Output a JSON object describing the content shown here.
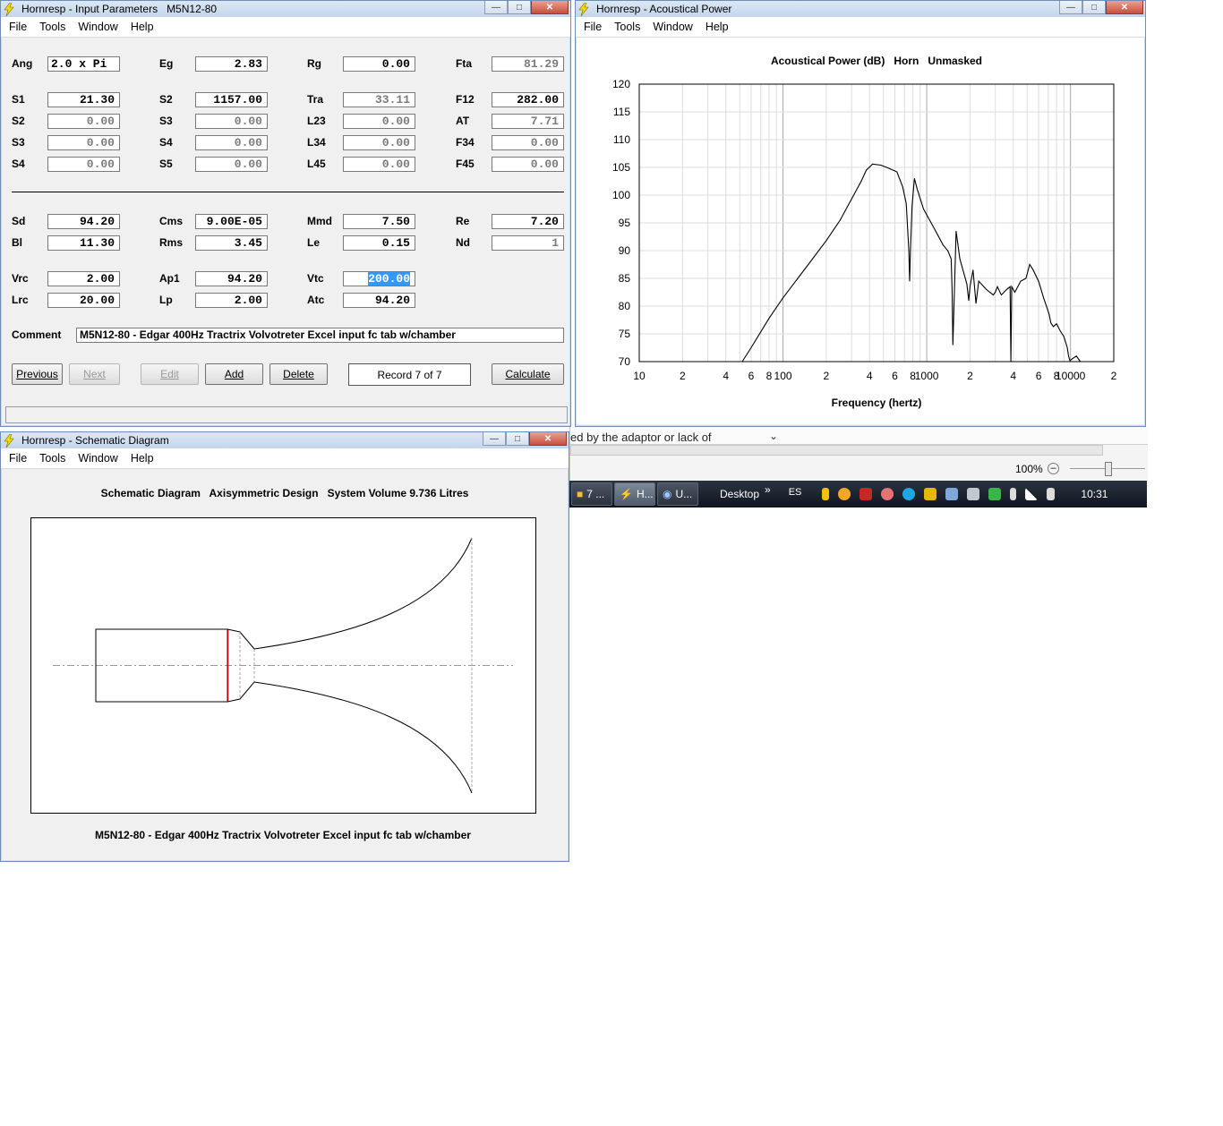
{
  "input_window": {
    "title": "Hornresp - Input Parameters   M5N12-80",
    "menu": [
      "File",
      "Tools",
      "Window",
      "Help"
    ],
    "params": [
      {
        "label": "Ang",
        "value": "2.0 x Pi",
        "grey": false
      },
      {
        "label": "Eg",
        "value": "2.83",
        "grey": false
      },
      {
        "label": "Rg",
        "value": "0.00",
        "grey": false
      },
      {
        "label": "Fta",
        "value": "81.29",
        "grey": true
      },
      {
        "label": "S1",
        "value": "21.30",
        "grey": false
      },
      {
        "label": "S2",
        "value": "1157.00",
        "grey": false
      },
      {
        "label": "Tra",
        "value": "33.11",
        "grey": true
      },
      {
        "label": "F12",
        "value": "282.00",
        "grey": false
      },
      {
        "label": "S2",
        "value": "0.00",
        "grey": true
      },
      {
        "label": "S3",
        "value": "0.00",
        "grey": true
      },
      {
        "label": "L23",
        "value": "0.00",
        "grey": true
      },
      {
        "label": "AT",
        "value": "7.71",
        "grey": true
      },
      {
        "label": "S3",
        "value": "0.00",
        "grey": true
      },
      {
        "label": "S4",
        "value": "0.00",
        "grey": true
      },
      {
        "label": "L34",
        "value": "0.00",
        "grey": true
      },
      {
        "label": "F34",
        "value": "0.00",
        "grey": true
      },
      {
        "label": "S4",
        "value": "0.00",
        "grey": true
      },
      {
        "label": "S5",
        "value": "0.00",
        "grey": true
      },
      {
        "label": "L45",
        "value": "0.00",
        "grey": true
      },
      {
        "label": "F45",
        "value": "0.00",
        "grey": true
      },
      {
        "label": "Sd",
        "value": "94.20",
        "grey": false
      },
      {
        "label": "Cms",
        "value": "9.00E-05",
        "grey": false
      },
      {
        "label": "Mmd",
        "value": "7.50",
        "grey": false
      },
      {
        "label": "Re",
        "value": "7.20",
        "grey": false
      },
      {
        "label": "Bl",
        "value": "11.30",
        "grey": false
      },
      {
        "label": "Rms",
        "value": "3.45",
        "grey": false
      },
      {
        "label": "Le",
        "value": "0.15",
        "grey": false
      },
      {
        "label": "Nd",
        "value": "1",
        "grey": true
      },
      {
        "label": "Vrc",
        "value": "2.00",
        "grey": false
      },
      {
        "label": "Ap1",
        "value": "94.20",
        "grey": false
      },
      {
        "label": "Vtc",
        "value": "200.00",
        "grey": false,
        "selected": true
      },
      {
        "label": "Lrc",
        "value": "20.00",
        "grey": false
      },
      {
        "label": "Lp",
        "value": "2.00",
        "grey": false
      },
      {
        "label": "Atc",
        "value": "94.20",
        "grey": false
      }
    ],
    "comment_label": "Comment",
    "comment_value": "M5N12-80 - Edgar 400Hz Tractrix Volvotreter Excel input fc tab w/chamber",
    "buttons": {
      "previous": "Previous",
      "next": "Next",
      "edit": "Edit",
      "add": "Add",
      "delete": "Delete",
      "record": "Record 7 of 7",
      "calculate": "Calculate"
    }
  },
  "power_window": {
    "title": "Hornresp - Acoustical Power",
    "menu": [
      "File",
      "Tools",
      "Window",
      "Help"
    ],
    "chart_title": "Acoustical Power (dB)   Horn   Unmasked",
    "xlabel": "Frequency (hertz)",
    "x_tick_labels": [
      "10",
      "2",
      "4",
      "6",
      "8",
      "100",
      "2",
      "4",
      "6",
      "8",
      "1000",
      "2",
      "4",
      "6",
      "8",
      "10000",
      "2"
    ],
    "y_tick_labels": [
      "120",
      "115",
      "110",
      "105",
      "100",
      "95",
      "90",
      "85",
      "80",
      "75",
      "70"
    ]
  },
  "chart_data": {
    "type": "line",
    "title": "Acoustical Power (dB)   Horn   Unmasked",
    "xlabel": "Frequency (hertz)",
    "ylabel": "",
    "x_scale": "log",
    "xlim": [
      10,
      20000
    ],
    "ylim": [
      70,
      120
    ],
    "grid": true,
    "series": [
      {
        "x": [
          52,
          60,
          80,
          100,
          150,
          200,
          250,
          300,
          350,
          380,
          420,
          480,
          550,
          620,
          680,
          720,
          750,
          760,
          770,
          790,
          820,
          860,
          950,
          1100,
          1300,
          1400,
          1480,
          1500,
          1520,
          1550,
          1600,
          1700,
          1900,
          1960,
          2000,
          2100,
          2200,
          2300,
          2600,
          2900,
          3000,
          3100,
          3300,
          3600,
          3800,
          3850,
          3900,
          4100,
          4500,
          4900,
          5200,
          5500,
          6000,
          6500,
          6900,
          7100,
          7300,
          7600,
          8000,
          8500,
          9000,
          9300,
          9500,
          9700,
          9900,
          10400,
          11000,
          11700
        ],
        "y": [
          70,
          72.5,
          77.8,
          81.5,
          87.5,
          91.8,
          95.5,
          99.3,
          102.5,
          104.5,
          105.6,
          105.4,
          104.8,
          104.2,
          101.5,
          98.5,
          90,
          84.5,
          90,
          98,
          103,
          101,
          97.5,
          94.5,
          91,
          90,
          88.5,
          83,
          73,
          81,
          93.5,
          88.5,
          84,
          81,
          83.5,
          86.5,
          80.5,
          84.5,
          83,
          82,
          82.5,
          83.5,
          82,
          83,
          83.5,
          70,
          83.5,
          82.5,
          84.5,
          85,
          87.5,
          86.5,
          84.5,
          81.5,
          79.5,
          78.5,
          77,
          76.3,
          76.8,
          75.5,
          74.5,
          73.3,
          72.5,
          71,
          70.2,
          70.6,
          71,
          70
        ]
      }
    ]
  },
  "schematic_window": {
    "title": "Hornresp - Schematic Diagram",
    "menu": [
      "File",
      "Tools",
      "Window",
      "Help"
    ],
    "header": "Schematic Diagram   Axisymmetric Design   System Volume 9.736 Litres",
    "footer": "M5N12-80 - Edgar 400Hz Tractrix Volvotreter Excel input fc tab w/chamber"
  },
  "background": {
    "doc_text": "ed by the adaptor or lack of",
    "zoom_label": "100%"
  },
  "taskbar": {
    "buttons": [
      "7 ...",
      "H...",
      "U..."
    ],
    "desktop_label": "Desktop",
    "chevron": "»",
    "lang": "ES",
    "clock": "10:31"
  }
}
